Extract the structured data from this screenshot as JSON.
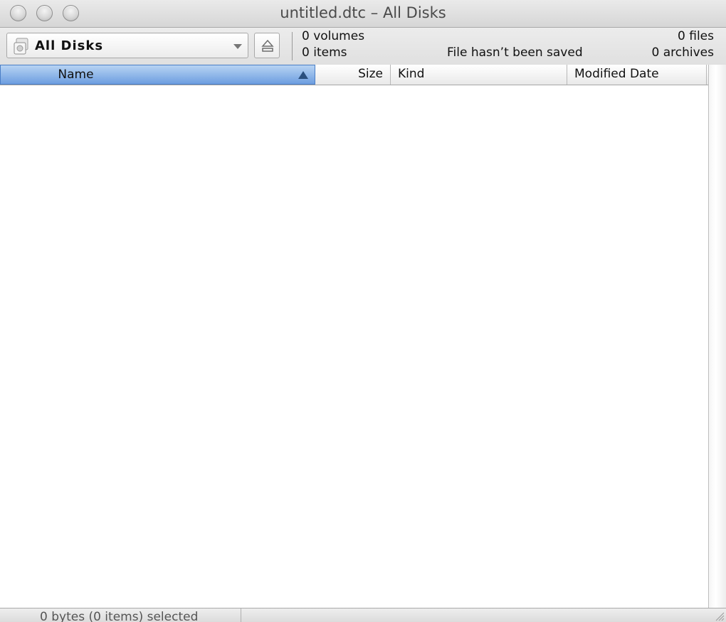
{
  "window": {
    "title": "untitled.dtc – All Disks"
  },
  "toolbar": {
    "disk_selector": {
      "selected": "All Disks",
      "icon": "disk-icon"
    },
    "eject_icon": "eject-icon",
    "stats": {
      "volumes": "0 volumes",
      "items": "0 items",
      "save_status": "File hasn’t been saved",
      "files": "0 files",
      "archives": "0 archives"
    }
  },
  "table": {
    "columns": [
      "Name",
      "Size",
      "Kind",
      "Modified Date"
    ],
    "sorted_column": "Name",
    "sort_direction": "ascending",
    "rows": []
  },
  "status": {
    "selection": "0 bytes (0 items) selected"
  },
  "colors": {
    "selected_header": "#8ab4ea",
    "chrome": "#e2e2e2"
  }
}
